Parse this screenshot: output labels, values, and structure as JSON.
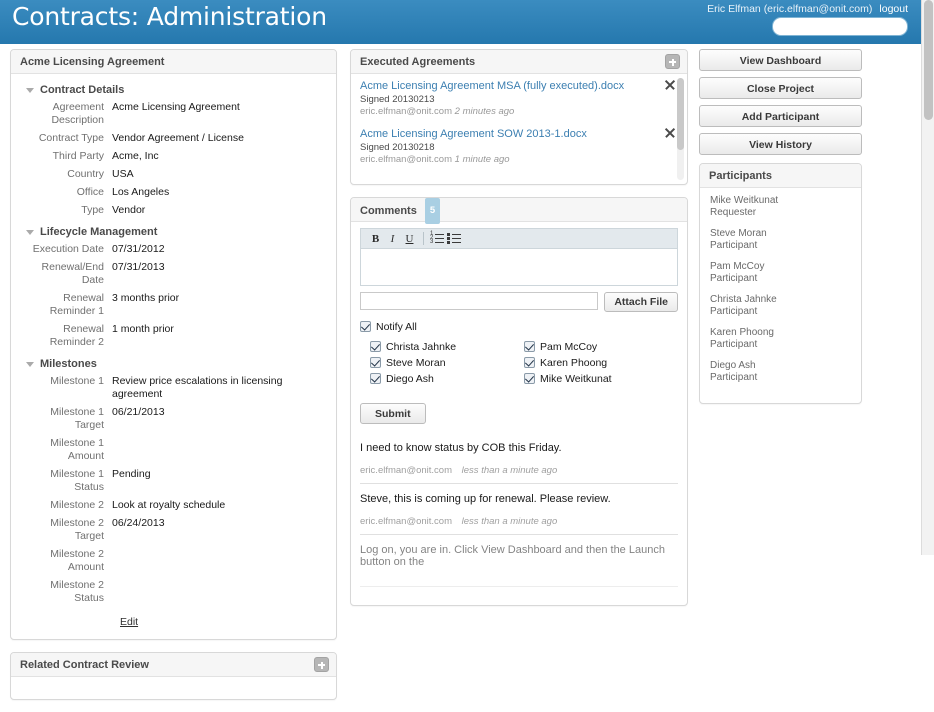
{
  "header": {
    "title": "Contracts: Administration",
    "user": "Eric Elfman (eric.elfman@onit.com)",
    "logout_label": "logout",
    "search_placeholder": "",
    "search_value": "",
    "brand_color": "#2b7fb8"
  },
  "contract_panel": {
    "title": "Acme Licensing Agreement",
    "sections": [
      {
        "title": "Contract Details",
        "fields": [
          {
            "label": "Agreement Description",
            "value": "Acme Licensing Agreement"
          },
          {
            "label": "Contract Type",
            "value": "Vendor Agreement / License"
          },
          {
            "label": "Third Party",
            "value": "Acme, Inc"
          },
          {
            "label": "Country",
            "value": "USA"
          },
          {
            "label": "Office",
            "value": "Los Angeles"
          },
          {
            "label": "Type",
            "value": "Vendor"
          }
        ]
      },
      {
        "title": "Lifecycle Management",
        "fields": [
          {
            "label": "Execution Date",
            "value": "07/31/2012"
          },
          {
            "label": "Renewal/End Date",
            "value": "07/31/2013"
          },
          {
            "label": "Renewal Reminder 1",
            "value": "3 months prior"
          },
          {
            "label": "Renewal Reminder 2",
            "value": "1 month prior"
          }
        ]
      },
      {
        "title": "Milestones",
        "fields": [
          {
            "label": "Milestone 1",
            "value": "Review price escalations in licensing agreement"
          },
          {
            "label": "Milestone 1 Target",
            "value": "06/21/2013"
          },
          {
            "label": "Milestone 1 Amount",
            "value": ""
          },
          {
            "label": "Milestone 1 Status",
            "value": "Pending"
          },
          {
            "label": "Milestone 2",
            "value": "Look at royalty schedule"
          },
          {
            "label": "Milestone 2 Target",
            "value": "06/24/2013"
          },
          {
            "label": "Milestone 2 Amount",
            "value": ""
          },
          {
            "label": "Milestone 2 Status",
            "value": ""
          }
        ]
      }
    ],
    "edit_label": "Edit"
  },
  "related_panel": {
    "title": "Related Contract Review"
  },
  "agreements_panel": {
    "title": "Executed Agreements",
    "items": [
      {
        "name": "Acme Licensing Agreement MSA (fully executed).docx",
        "signed": "Signed 20130213",
        "author": "eric.elfman@onit.com",
        "when": "2 minutes ago"
      },
      {
        "name": "Acme Licensing Agreement SOW 2013-1.docx",
        "signed": "Signed 20130218",
        "author": "eric.elfman@onit.com",
        "when": "1 minute ago"
      }
    ]
  },
  "comments_panel": {
    "title": "Comments",
    "badge": "5",
    "toolbar": {
      "bold": "B",
      "italic": "I",
      "underline": "U"
    },
    "editor_value": "",
    "attach_value": "",
    "attach_label": "Attach File",
    "notify_all_label": "Notify All",
    "notify_all_checked": true,
    "recipients_left": [
      {
        "label": "Christa Jahnke",
        "checked": true
      },
      {
        "label": "Steve Moran",
        "checked": true
      },
      {
        "label": "Diego Ash",
        "checked": true
      }
    ],
    "recipients_right": [
      {
        "label": "Pam McCoy",
        "checked": true
      },
      {
        "label": "Karen Phoong",
        "checked": true
      },
      {
        "label": "Mike Weitkunat",
        "checked": true
      }
    ],
    "submit_label": "Submit",
    "feed": [
      {
        "text": "I need to know status by COB this Friday.",
        "author": "eric.elfman@onit.com",
        "when": "less than a minute ago"
      },
      {
        "text": "Steve, this is coming up for renewal. Please review.",
        "author": "eric.elfman@onit.com",
        "when": "less than a minute ago"
      },
      {
        "text": "Log on, you are in. Click View Dashboard and then the Launch button on the",
        "author": "",
        "when": ""
      }
    ]
  },
  "rail": {
    "buttons": [
      {
        "label": "View Dashboard"
      },
      {
        "label": "Close Project"
      },
      {
        "label": "Add Participant"
      },
      {
        "label": "View History"
      }
    ],
    "participants_title": "Participants",
    "participants": [
      {
        "name": "Mike Weitkunat",
        "role": "Requester"
      },
      {
        "name": "Steve Moran",
        "role": "Participant"
      },
      {
        "name": "Pam McCoy",
        "role": "Participant"
      },
      {
        "name": "Christa Jahnke",
        "role": "Participant"
      },
      {
        "name": "Karen Phoong",
        "role": "Participant"
      },
      {
        "name": "Diego Ash",
        "role": "Participant"
      }
    ]
  }
}
